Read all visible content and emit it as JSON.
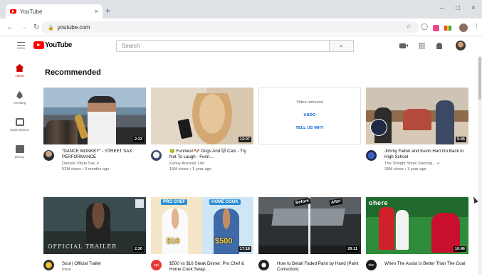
{
  "browser": {
    "tab_title": "YouTube",
    "url": "youtube.com",
    "tab_close": "×",
    "new_tab": "+",
    "minimize": "–",
    "maximize": "□",
    "close": "×"
  },
  "header": {
    "logo_text": "YouTube",
    "search_placeholder": "Search",
    "search_button_icon": "magnifier"
  },
  "guide": {
    "items": [
      {
        "label": "Home",
        "icon": "home-icon",
        "active": true
      },
      {
        "label": "Trending",
        "icon": "trending-icon"
      },
      {
        "label": "Subscriptions",
        "icon": "subscriptions-icon"
      },
      {
        "label": "Library",
        "icon": "library-icon"
      }
    ]
  },
  "section_title": "Recommended",
  "videos": [
    {
      "title": "\"DANCE MONKEY\" - STREET SAX PERFORMANCE",
      "channel": "Daniele Vitale Sax",
      "verified": true,
      "meta": "52M views • 3 months ago",
      "duration": "2:23"
    },
    {
      "title": "🐸 Funniest 🐶 Dogs And 🐱 Cats - Try Not To Laugh - Funn...",
      "channel": "Funny Animals' Life",
      "verified": false,
      "meta": "15M views • 1 year ago",
      "duration": "12:07"
    },
    {
      "removed_message": "Video removed",
      "undo": "UNDO",
      "tell_us_why": "TELL US WHY"
    },
    {
      "title": "Jimmy Fallon and Kevin Hart Go Back to High School",
      "channel": "The Tonight Show Starring...",
      "verified": true,
      "meta": "39M views • 1 year ago",
      "duration": "5:45"
    },
    {
      "title": "Soul | Official Trailer",
      "channel": "Pixar",
      "thumb_text": "OFFICIAL TRAILER",
      "duration": "2:20"
    },
    {
      "title": "$500 vs $16 Steak Dinner: Pro Chef & Home Cook Swap...",
      "thumb_label_left": "PRO CHEF",
      "thumb_label_right": "HOME COOK",
      "price_left": "$16",
      "price_right": "$500",
      "duration": "17:18"
    },
    {
      "title": "How to Detail Faded Paint by Hand (Paint Correction)",
      "thumb_label_left": "Before",
      "thumb_label_right": "After",
      "duration": "29:11"
    },
    {
      "title": "When The Assist is Better Than The Goal",
      "thumb_text": "ohere",
      "duration": "10:46"
    }
  ],
  "colors": {
    "brand_red": "#ff0000",
    "link_blue": "#065fd4",
    "text_secondary": "#606060"
  }
}
